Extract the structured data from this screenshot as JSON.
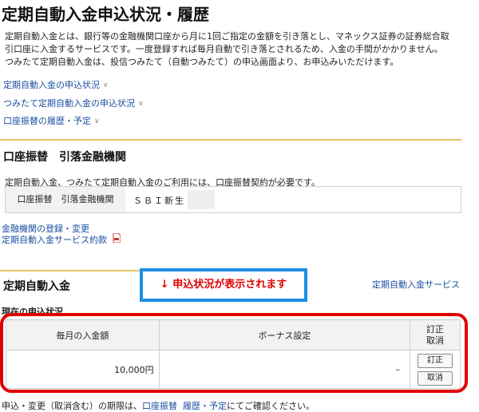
{
  "page_title": "定期自動入金申込状況・履歴",
  "intro": {
    "line1": "定期自動入金とは、銀行等の金融機関口座から月に1回ご指定の金額を引き落とし、マネックス証券の証券総合取",
    "line2": "引口座に入金するサービスです。一度登録すれば毎月自動で引き落とされるため、入金の手間がかかりません。",
    "line3": "つみたて定期自動入金は、投信つみたて（自動つみたて）の申込画面より、お申込みいただけます。"
  },
  "nav": [
    {
      "label": "定期自動入金の申込状況"
    },
    {
      "label": "つみたて定期自動入金の申込状況"
    },
    {
      "label": "口座振替の履歴・予定"
    }
  ],
  "bank_section": {
    "title": "口座振替　引落金融機関",
    "note": "定期自動入金、つみたて定期自動入金のご利用には、口座振替契約が必要です。",
    "label": "口座振替　引落金融機関",
    "value": "ＳＢＩ新生",
    "link_register": "金融機関の登録・変更",
    "link_terms": "定期自動入金サービス約款"
  },
  "auto_section": {
    "title": "定期自動入金",
    "service_link": "定期自動入金サービス",
    "status_label": "現在の申込状況",
    "callout": "↓ 申込状況が表示されます",
    "table": {
      "headers": [
        "毎月の入金額",
        "ボーナス設定",
        "訂正\n取消"
      ],
      "header_edit_1": "訂正",
      "header_edit_2": "取消",
      "row": {
        "amount": "10,000円",
        "bonus": "–",
        "edit_button": "訂正",
        "cancel_button": "取消"
      }
    }
  },
  "footer": {
    "prefix": "申込・変更（取消含む）の期限は、",
    "link1": "口座振替",
    "link2": "履歴・予定",
    "suffix": "にてご確認ください。"
  },
  "colors": {
    "accent_rule": "#e3c466",
    "link": "#1a4fa0",
    "highlight_red": "#e00000",
    "callout_blue": "#1a8fe6"
  }
}
